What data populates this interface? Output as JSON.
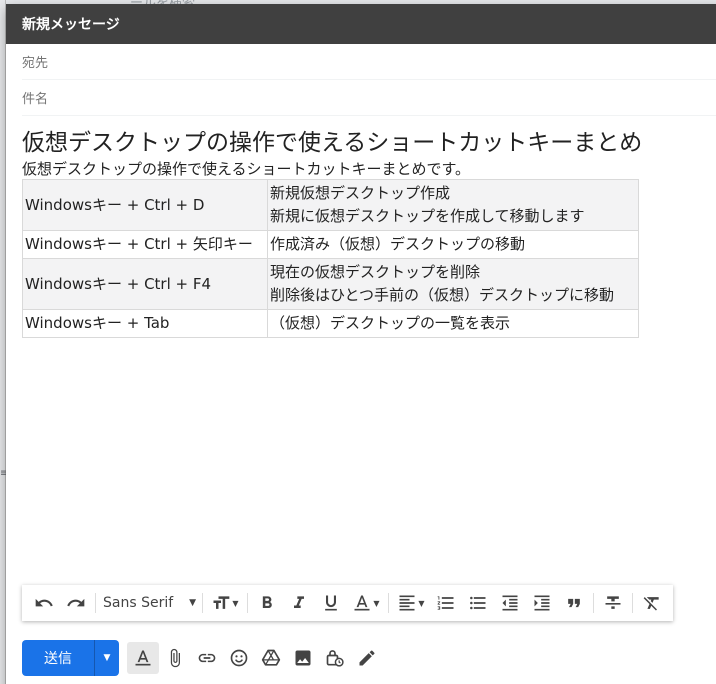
{
  "background": {
    "partial_text": "ールを検索"
  },
  "compose": {
    "header_title": "新規メッセージ",
    "to_label": "宛先",
    "subject_label": "件名"
  },
  "body": {
    "title": "仮想デスクトップの操作で使えるショートカットキーまとめ",
    "subtitle": "仮想デスクトップの操作で使えるショートカットキーまとめです。",
    "table": [
      {
        "key": "Windowsキー + Ctrl + D",
        "desc": [
          "新規仮想デスクトップ作成",
          "新規に仮想デスクトップを作成して移動します"
        ]
      },
      {
        "key": "Windowsキー + Ctrl + 矢印キー",
        "desc": [
          "作成済み（仮想）デスクトップの移動"
        ]
      },
      {
        "key": "Windowsキー + Ctrl + F4",
        "desc": [
          "現在の仮想デスクトップを削除",
          "削除後はひとつ手前の（仮想）デスクトップに移動"
        ]
      },
      {
        "key": "Windowsキー + Tab",
        "desc": [
          "（仮想）デスクトップの一覧を表示"
        ]
      }
    ]
  },
  "formatting_bar": {
    "font": "Sans Serif"
  },
  "bottom_bar": {
    "send_label": "送信"
  },
  "colors": {
    "header_bg": "#404040",
    "send_button": "#1a73e8"
  }
}
